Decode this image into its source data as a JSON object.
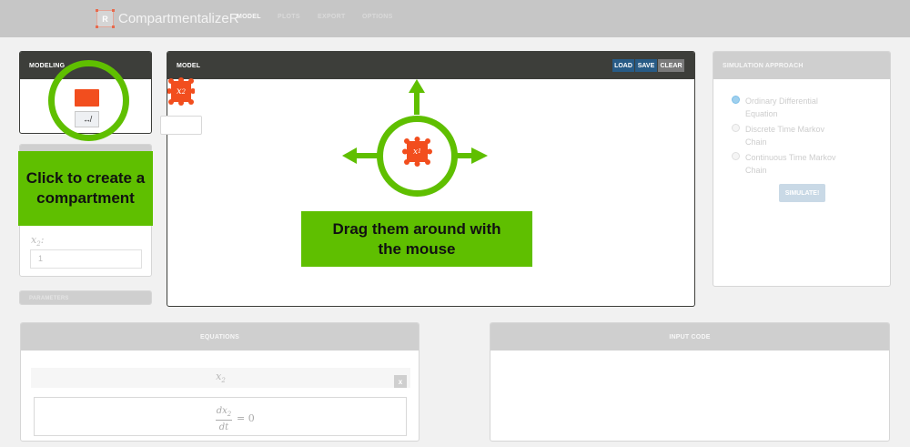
{
  "app": {
    "brand": "CompartmentalizeR",
    "logo_letter": "R"
  },
  "nav": {
    "model": "MODEL",
    "plots": "PLOTS",
    "export": "EXPORT",
    "options": "OPTIONS"
  },
  "modeling": {
    "title": "MODELING",
    "flow_glyph": "↮"
  },
  "params": {
    "label_var": "x",
    "label_sub": "2",
    "label_colon": ":",
    "value": "1"
  },
  "third_panel": {
    "title": "PARAMETERS"
  },
  "model": {
    "title": "MODEL",
    "load": "LOAD",
    "save": "SAVE",
    "clear": "CLEAR"
  },
  "nodes": {
    "x2": {
      "var": "x",
      "sub": "2",
      "color": "#f24e1e"
    },
    "x1": {
      "var": "x",
      "sub": "1",
      "color": "#f24e1e"
    }
  },
  "simulation": {
    "title": "SIMULATION APPROACH",
    "options": [
      "Ordinary Differential Equation",
      "Discrete Time Markov Chain",
      "Continuous Time Markov Chain"
    ],
    "selected": "Ordinary Differential Equation",
    "button": "SIMULATE!"
  },
  "equations": {
    "title": "EQUATIONS",
    "var": "x",
    "var_sub": "2",
    "delete": "x",
    "num": "dx",
    "num_sub": "2",
    "den": "dt",
    "rhs": "= 0"
  },
  "input_code": {
    "title": "INPUT CODE"
  },
  "tutorial": {
    "create_callout": "Click to create a compartment",
    "drag_callout": "Drag them around with the mouse",
    "accent": "#5fbf00"
  }
}
